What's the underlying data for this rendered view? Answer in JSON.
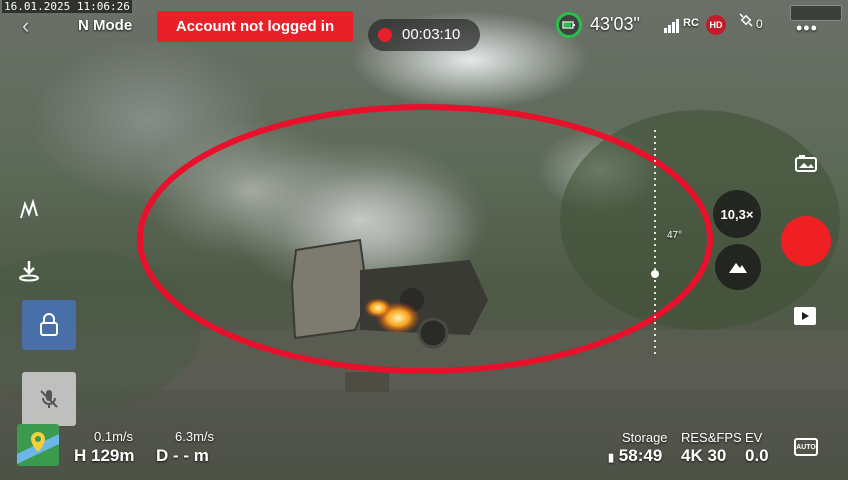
{
  "overlay": {
    "datestamp": "16.01.2025 11:06:26",
    "watermark_icon": "camera-watermark-icon"
  },
  "top_bar": {
    "back_icon": "chevron-left-icon",
    "back_glyph": "‹",
    "mode": "N Mode",
    "account_banner": "Account not logged in",
    "record_time": "00:03:10",
    "battery_icon": "battery-ring-icon",
    "battery_color": "#26c04a",
    "flight_time": "43'03\"",
    "rc_label": "RC",
    "hd_label": "HD",
    "satellite_count": "0",
    "more_glyph": "•••"
  },
  "left_controls": {
    "flight_route_icon": "flight-route-icon",
    "landing_icon": "landing-icon",
    "lock_icon": "lock-icon",
    "mic_icon": "mic-muted-icon",
    "map_icon": "map-icon"
  },
  "telemetry": {
    "vertical_speed": "0.1m/s",
    "horizontal_speed": "6.3m/s",
    "height": "H 129m",
    "distance": "D - - m",
    "storage_label": "Storage",
    "storage_value": "58:49",
    "res_fps_label": "RES&FPS",
    "res_fps_value": "4K 30",
    "ev_label": "EV",
    "ev_value": "0.0",
    "auto_label": "AUTO"
  },
  "right_controls": {
    "zoom": "10,3×",
    "gimbal_angle": "47°",
    "shutter_color": "#ee2024",
    "mountain_icon": "mountain-icon",
    "photo_mode_icon": "photo-mode-icon",
    "playback_icon": "playback-icon"
  },
  "annotation": {
    "ellipse_color": "#e8102a"
  }
}
